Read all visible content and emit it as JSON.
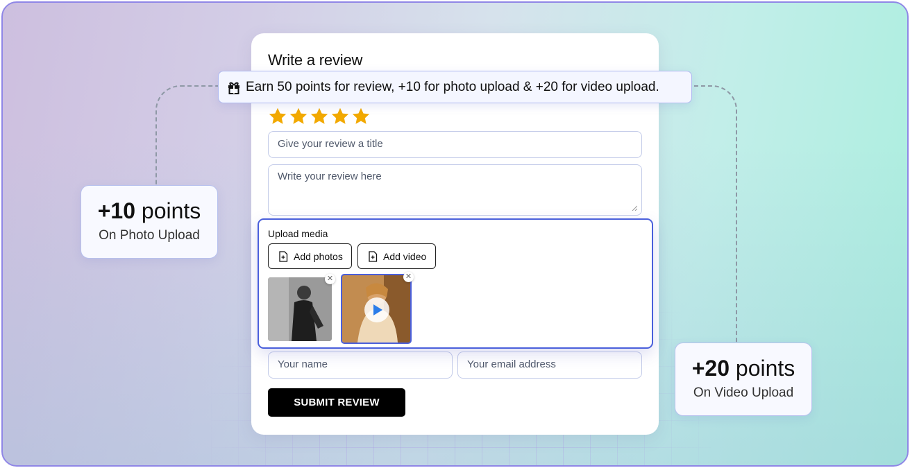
{
  "review": {
    "title": "Write a review",
    "banner_text": "Earn 50 points for review, +10 for photo upload & +20 for video upload.",
    "banner_icon": "gift-icon",
    "rating": 5,
    "rating_max": 5,
    "star_color": "#f2a900",
    "title_placeholder": "Give your review a title",
    "body_placeholder": "Write your review here",
    "name_placeholder": "Your name",
    "email_placeholder": "Your email address",
    "submit_label": "SUBMIT REVIEW"
  },
  "upload": {
    "title": "Upload media",
    "add_photos_label": "Add photos",
    "add_video_label": "Add video",
    "accent_color": "#4a5fdb"
  },
  "photo_bonus": {
    "amount": "+10",
    "unit": "points",
    "caption": "On Photo Upload"
  },
  "video_bonus": {
    "amount": "+20",
    "unit": "points",
    "caption": "On Video Upload"
  }
}
